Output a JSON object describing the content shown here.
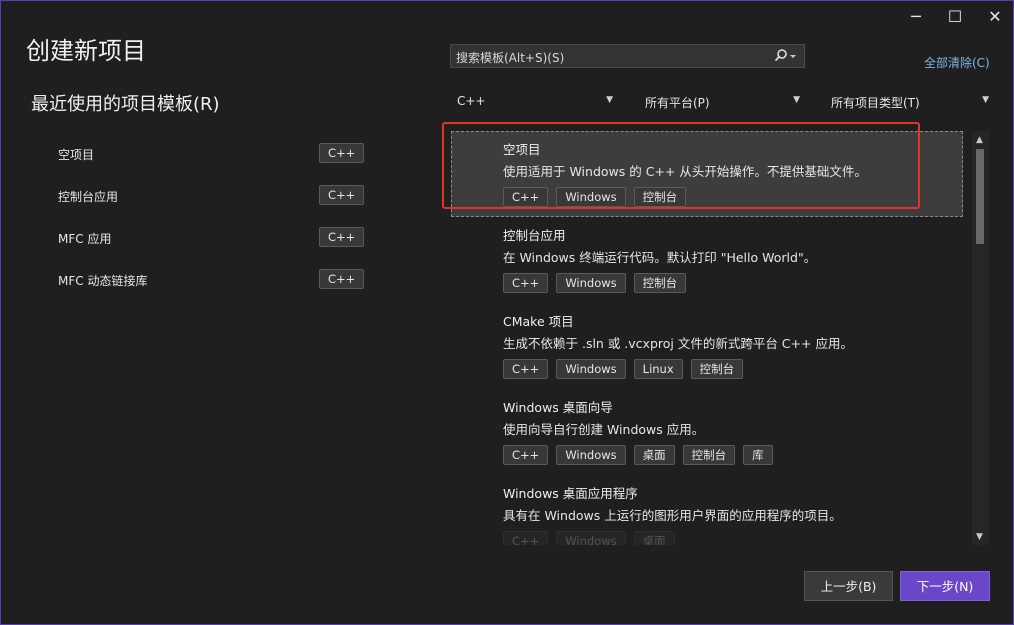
{
  "window": {
    "title": "创建新项目",
    "controls": [
      {
        "name": "minimize",
        "glyph": "─"
      },
      {
        "name": "maximize",
        "glyph": "☐"
      },
      {
        "name": "close",
        "glyph": "✕"
      }
    ]
  },
  "recent": {
    "heading": "最近使用的项目模板(R)",
    "items": [
      {
        "label": "空项目",
        "tag": "C++"
      },
      {
        "label": "控制台应用",
        "tag": "C++"
      },
      {
        "label": "MFC 应用",
        "tag": "C++"
      },
      {
        "label": "MFC 动态链接库",
        "tag": "C++"
      }
    ]
  },
  "search": {
    "placeholder": "搜索模板(Alt+S)(S)",
    "icon": "search-icon"
  },
  "clear_all": "全部清除(C)",
  "filters": {
    "language": "C++",
    "platform": "所有平台(P)",
    "project_type": "所有项目类型(T)"
  },
  "templates": [
    {
      "name": "空项目",
      "desc": "使用适用于 Windows 的 C++ 从头开始操作。不提供基础文件。",
      "tags": [
        "C++",
        "Windows",
        "控制台"
      ]
    },
    {
      "name": "控制台应用",
      "desc": "在 Windows 终端运行代码。默认打印 \"Hello World\"。",
      "tags": [
        "C++",
        "Windows",
        "控制台"
      ]
    },
    {
      "name": "CMake 项目",
      "desc": "生成不依赖于 .sln 或 .vcxproj 文件的新式跨平台 C++ 应用。",
      "tags": [
        "C++",
        "Windows",
        "Linux",
        "控制台"
      ]
    },
    {
      "name": "Windows 桌面向导",
      "desc": "使用向导自行创建 Windows 应用。",
      "tags": [
        "C++",
        "Windows",
        "桌面",
        "控制台",
        "库"
      ]
    },
    {
      "name": "Windows 桌面应用程序",
      "desc": "具有在 Windows 上运行的图形用户界面的应用程序的项目。",
      "tags": [
        "C++",
        "Windows",
        "桌面"
      ]
    }
  ],
  "buttons": {
    "back": "上一步(B)",
    "next": "下一步(N)"
  }
}
